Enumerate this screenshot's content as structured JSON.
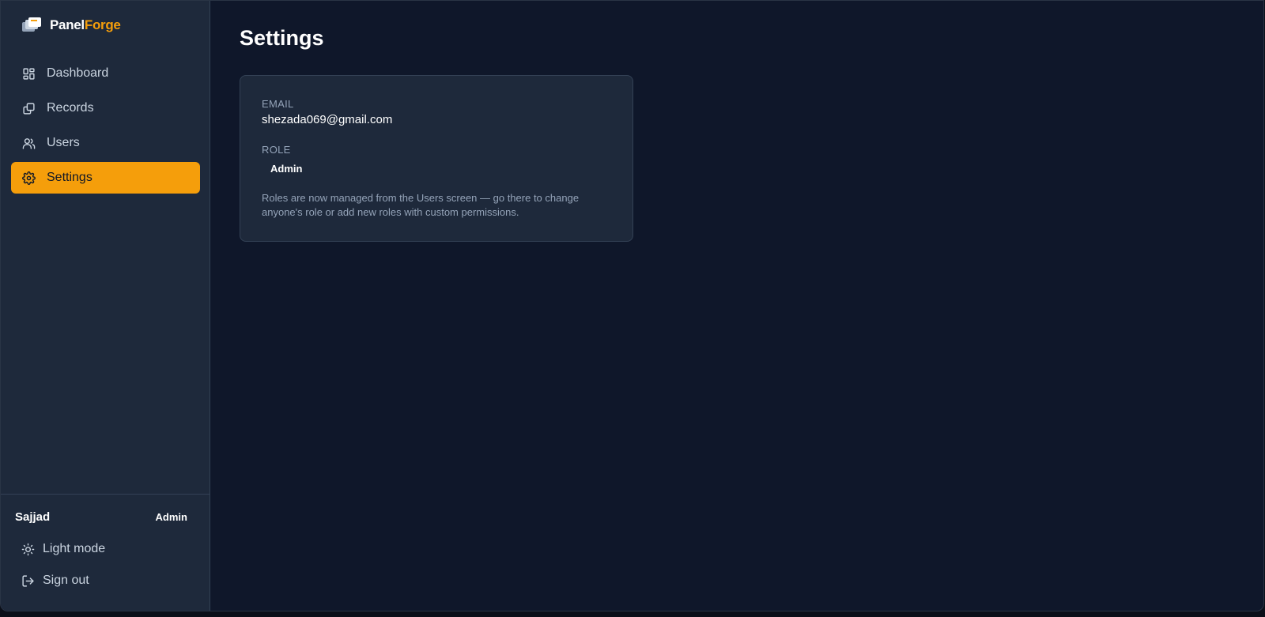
{
  "brand": {
    "name_part1": "Panel",
    "name_part2": "Forge"
  },
  "sidebar": {
    "items": [
      {
        "label": "Dashboard",
        "icon": "dashboard-icon"
      },
      {
        "label": "Records",
        "icon": "records-icon"
      },
      {
        "label": "Users",
        "icon": "users-icon"
      },
      {
        "label": "Settings",
        "icon": "gear-icon",
        "active": true
      }
    ],
    "footer": {
      "user_name": "Sajjad",
      "user_role": "Admin",
      "light_mode_label": "Light mode",
      "sign_out_label": "Sign out"
    }
  },
  "main": {
    "title": "Settings",
    "card": {
      "email_label": "EMAIL",
      "email_value": "shezada069@gmail.com",
      "role_label": "ROLE",
      "role_value": "Admin",
      "note": "Roles are now managed from the Users screen — go there to change anyone's role or add new roles with custom permissions."
    }
  },
  "colors": {
    "accent": "#f59e0b",
    "sidebar_bg": "#1e293b",
    "main_bg": "#0f172a"
  }
}
